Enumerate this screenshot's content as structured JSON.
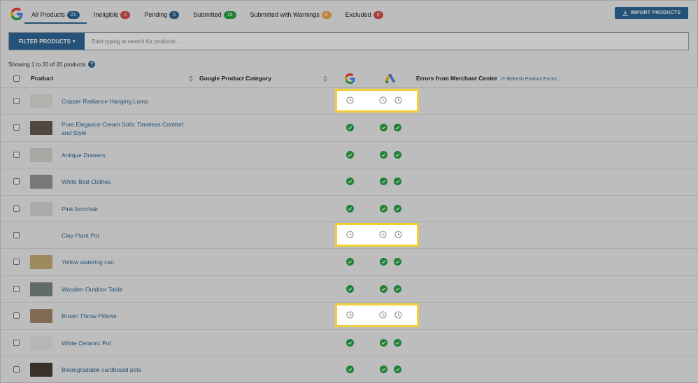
{
  "tabs": [
    {
      "label": "All Products",
      "count": "21",
      "color": "#2f6a9a",
      "active": true
    },
    {
      "label": "Ineligible",
      "count": "0",
      "color": "#d9534f"
    },
    {
      "label": "Pending",
      "count": "5",
      "color": "#2f6a9a"
    },
    {
      "label": "Submitted",
      "count": "16",
      "color": "#28a745"
    },
    {
      "label": "Submitted with Warnings",
      "count": "0",
      "color": "#f0ad4e"
    },
    {
      "label": "Excluded",
      "count": "0",
      "color": "#d9534f"
    }
  ],
  "import_button": "IMPORT PRODUCTS",
  "filter": {
    "button_label": "FILTER PRODUCTS",
    "placeholder": "Start typing to search for products..."
  },
  "showing_text": "Showing 1 to 20 of 20 products",
  "columns": {
    "product": "Product",
    "category": "Google Product Category",
    "errors": "Errors from Merchant Center",
    "refresh": "Refresh Product Errors"
  },
  "products": [
    {
      "name": "Copper Radiance Hanging Lamp",
      "status": "pending"
    },
    {
      "name": "Pure Elegance Cream Sofa: Timeless Comfort and Style",
      "status": "approved"
    },
    {
      "name": "Antique Drawers",
      "status": "approved"
    },
    {
      "name": "White Bed Clothes",
      "status": "approved"
    },
    {
      "name": "Pink Armchair",
      "status": "approved"
    },
    {
      "name": "Clay Plant Pot",
      "status": "pending"
    },
    {
      "name": "Yellow watering can",
      "status": "approved"
    },
    {
      "name": "Wooden Outdoor Table",
      "status": "approved"
    },
    {
      "name": "Brown Throw Pillows",
      "status": "pending"
    },
    {
      "name": "White Ceramic Pot",
      "status": "approved"
    },
    {
      "name": "Biodegradable cardboard pots",
      "status": "approved"
    }
  ],
  "colors": {
    "accent": "#2f6a9a",
    "approved": "#28a745",
    "highlight": "#f2cf37"
  }
}
